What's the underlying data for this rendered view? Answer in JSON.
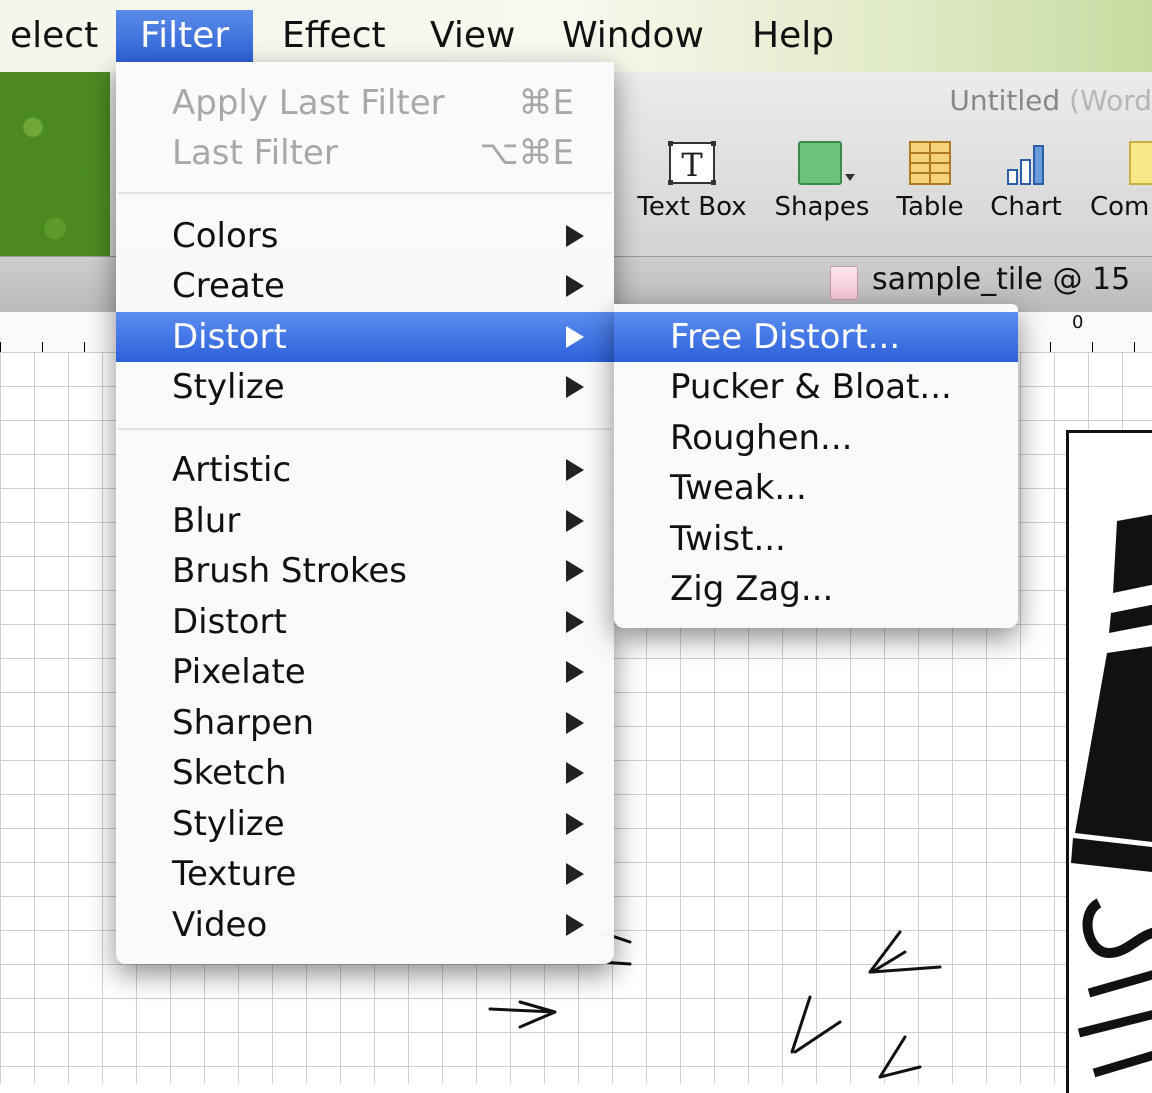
{
  "menubar": {
    "items": [
      "elect",
      "Filter",
      "Effect",
      "View",
      "Window",
      "Help"
    ]
  },
  "window": {
    "title": "Untitled",
    "title_suffix": "(Word",
    "tools": [
      {
        "label": "Text Box",
        "icon": "text-box-icon"
      },
      {
        "label": "Shapes",
        "icon": "shapes-icon"
      },
      {
        "label": "Table",
        "icon": "table-icon"
      },
      {
        "label": "Chart",
        "icon": "chart-icon"
      },
      {
        "label": "Com",
        "icon": "comment-icon"
      }
    ],
    "tab_title": "sample_tile @ 15",
    "ruler_zero": "0"
  },
  "filter_menu": {
    "top": [
      {
        "label": "Apply Last Filter",
        "shortcut": "⌘E",
        "disabled": true
      },
      {
        "label": "Last Filter",
        "shortcut": "⌥⌘E",
        "disabled": true
      }
    ],
    "illustrator": [
      {
        "label": "Colors"
      },
      {
        "label": "Create"
      },
      {
        "label": "Distort",
        "selected": true
      },
      {
        "label": "Stylize"
      }
    ],
    "photoshop": [
      {
        "label": "Artistic"
      },
      {
        "label": "Blur"
      },
      {
        "label": "Brush Strokes"
      },
      {
        "label": "Distort"
      },
      {
        "label": "Pixelate"
      },
      {
        "label": "Sharpen"
      },
      {
        "label": "Sketch"
      },
      {
        "label": "Stylize"
      },
      {
        "label": "Texture"
      },
      {
        "label": "Video"
      }
    ]
  },
  "distort_submenu": {
    "items": [
      "Free Distort...",
      "Pucker & Bloat...",
      "Roughen...",
      "Tweak...",
      "Twist...",
      "Zig Zag..."
    ],
    "selected_index": 0
  }
}
